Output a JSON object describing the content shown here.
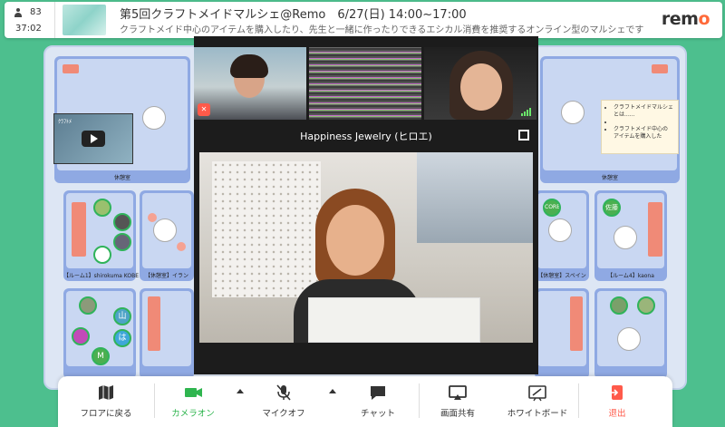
{
  "header": {
    "participant_count": "83",
    "elapsed_time": "37:02",
    "event_title": "第5回クラフトメイドマルシェ@Remo　6/27(日) 14:00~17:00",
    "event_description": "クラフトメイド中心のアイテムを購入したり、先生と一緒に作ったりできるエシカル消費を推奨するオンライン型のマルシェです",
    "logo_text_pre": "rem",
    "logo_text_o": "o"
  },
  "video_panel": {
    "main_title": "Happiness Jewelry (ヒロエ)"
  },
  "floor": {
    "yt_thumbnail_title": "ｸﾗﾌﾄﾒ",
    "note_items": [
      "クラフトメイドマルシェとは......",
      "",
      "クラフトメイド中心のアイテムを購入した"
    ],
    "rooms": [
      {
        "label": "休憩室"
      },
      {
        "label": "休憩室"
      },
      {
        "label": "【ルーム1】shirokuma KOBE"
      },
      {
        "label": "【休憩室】イラン"
      },
      {
        "label": "【休憩室】スペイン"
      },
      {
        "label": "【ルーム4】kaona"
      }
    ],
    "avatars": [
      {
        "label": "山"
      },
      {
        "label": "は"
      },
      {
        "label": "M"
      },
      {
        "label": "佐藤"
      },
      {
        "label": "CORE"
      }
    ]
  },
  "toolbar": {
    "buttons": [
      {
        "label": "フロアに戻る",
        "icon": "map-icon"
      },
      {
        "label": "カメラオン",
        "icon": "camera-icon"
      },
      {
        "label": "マイクオフ",
        "icon": "mic-off-icon"
      },
      {
        "label": "チャット",
        "icon": "chat-icon"
      },
      {
        "label": "画面共有",
        "icon": "screen-share-icon"
      },
      {
        "label": "ホワイトボード",
        "icon": "whiteboard-icon"
      },
      {
        "label": "退出",
        "icon": "exit-icon"
      }
    ]
  },
  "colors": {
    "background": "#4dbf8e",
    "camera_on": "#2fb54f",
    "exit": "#ff5a4a",
    "room": "#8fa9e3",
    "accent_logo": "#ff6a3a"
  }
}
